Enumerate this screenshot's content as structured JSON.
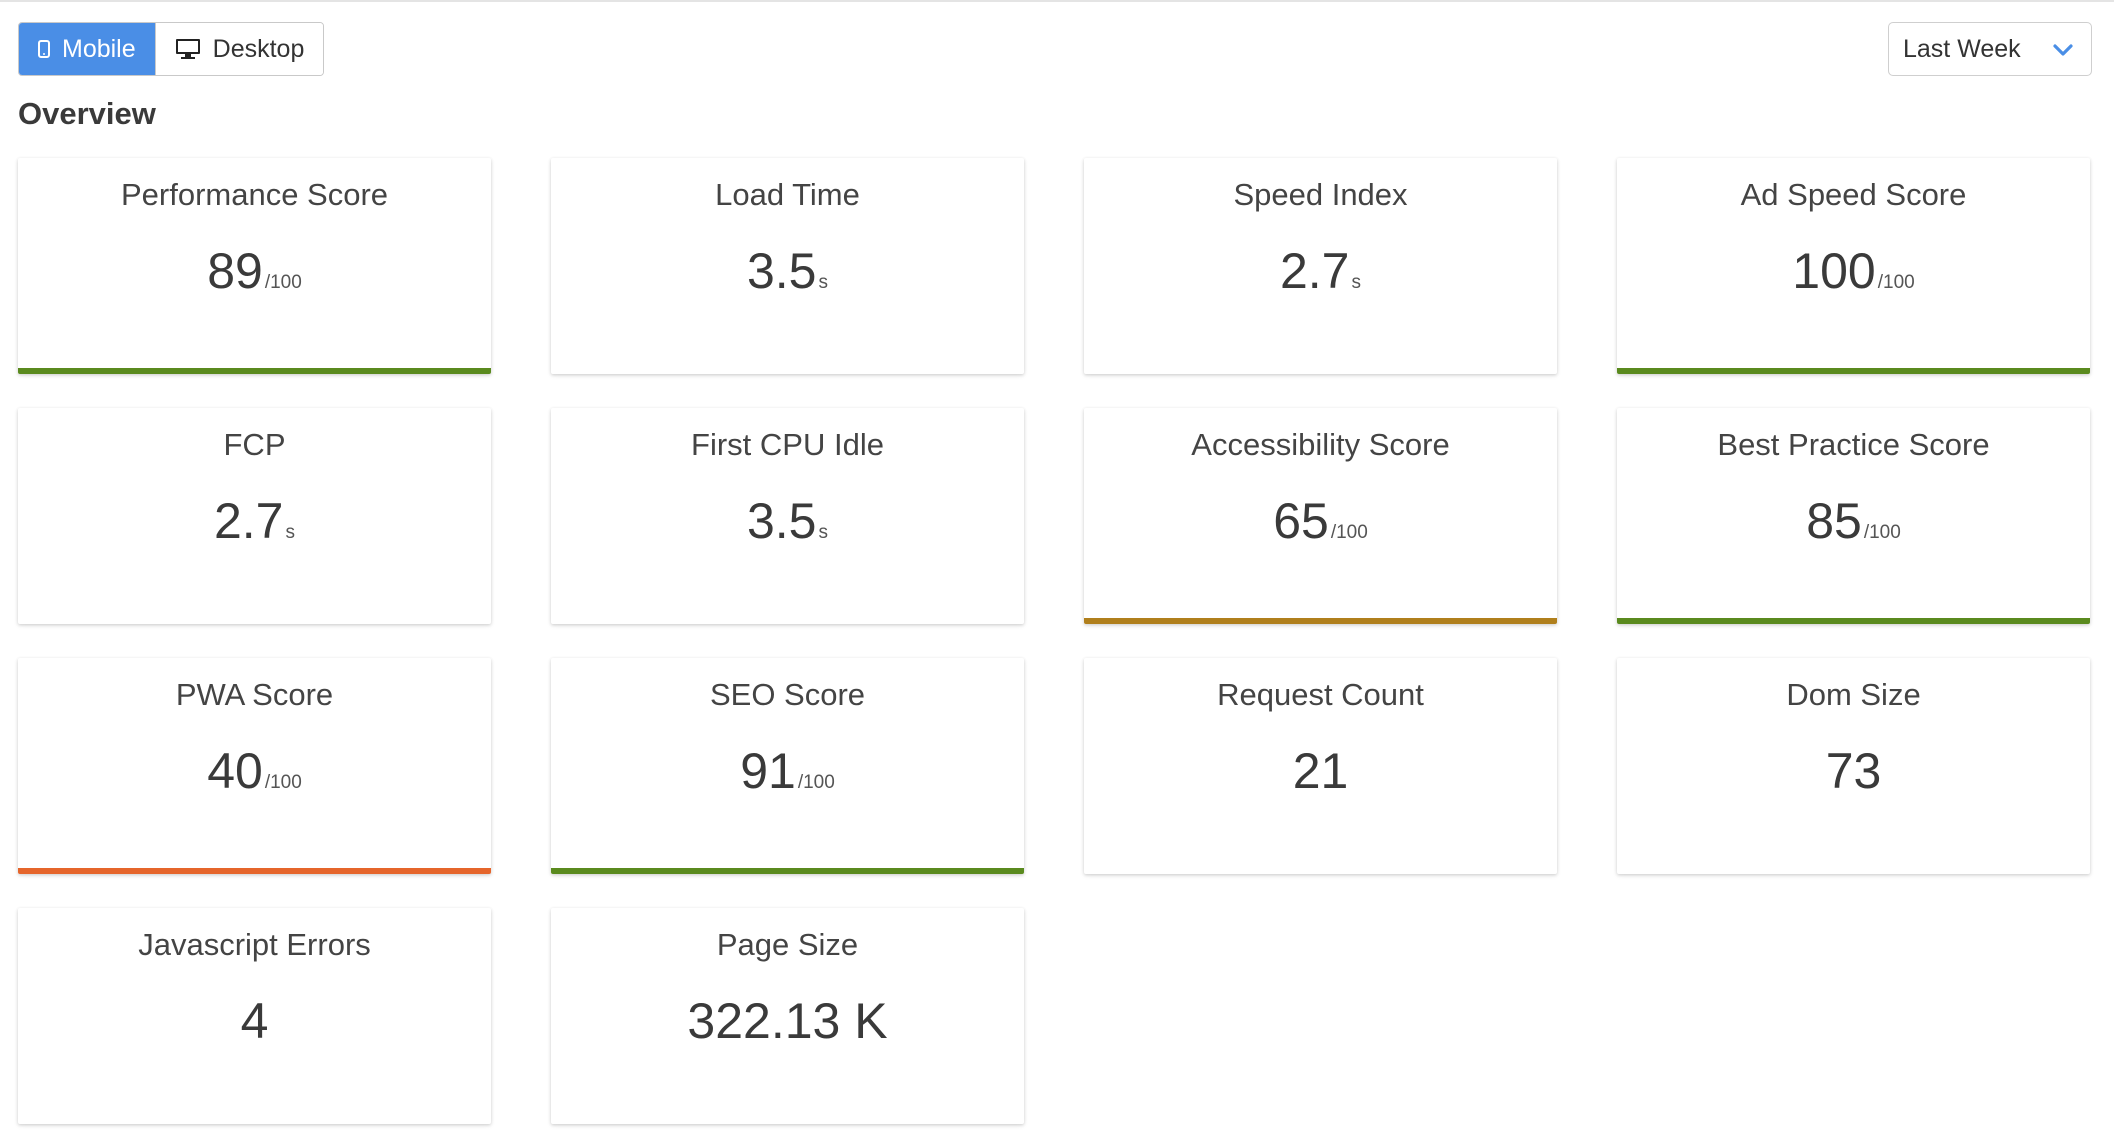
{
  "device_toggle": {
    "mobile_label": "Mobile",
    "desktop_label": "Desktop",
    "active": "mobile"
  },
  "date_range": {
    "selected": "Last Week"
  },
  "section_title": "Overview",
  "colors": {
    "accent": "#4a8ee6",
    "good": "#5a8a1e",
    "average": "#b07f1c",
    "poor": "#e5652b"
  },
  "metrics": [
    {
      "label": "Performance Score",
      "value": "89",
      "unit": "/100",
      "status": "good"
    },
    {
      "label": "Load Time",
      "value": "3.5",
      "unit": "s",
      "status": "none"
    },
    {
      "label": "Speed Index",
      "value": "2.7",
      "unit": "s",
      "status": "none"
    },
    {
      "label": "Ad Speed Score",
      "value": "100",
      "unit": "/100",
      "status": "good"
    },
    {
      "label": "FCP",
      "value": "2.7",
      "unit": "s",
      "status": "none"
    },
    {
      "label": "First CPU Idle",
      "value": "3.5",
      "unit": "s",
      "status": "none"
    },
    {
      "label": "Accessibility Score",
      "value": "65",
      "unit": "/100",
      "status": "average"
    },
    {
      "label": "Best Practice Score",
      "value": "85",
      "unit": "/100",
      "status": "good"
    },
    {
      "label": "PWA Score",
      "value": "40",
      "unit": "/100",
      "status": "poor"
    },
    {
      "label": "SEO Score",
      "value": "91",
      "unit": "/100",
      "status": "good"
    },
    {
      "label": "Request Count",
      "value": "21",
      "unit": "",
      "status": "none"
    },
    {
      "label": "Dom Size",
      "value": "73",
      "unit": "",
      "status": "none"
    },
    {
      "label": "Javascript Errors",
      "value": "4",
      "unit": "",
      "status": "none"
    },
    {
      "label": "Page Size",
      "value": "322.13 K",
      "unit": "",
      "status": "none"
    }
  ]
}
